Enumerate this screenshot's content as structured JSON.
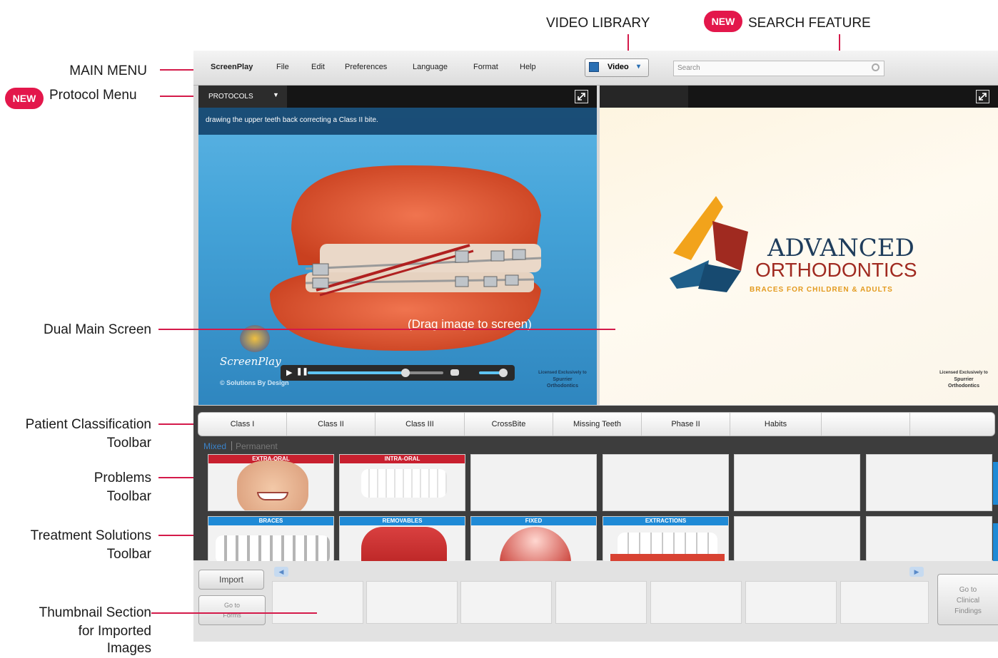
{
  "annotations": {
    "video_library": "VIDEO LIBRARY",
    "search_feature": "SEARCH FEATURE",
    "main_menu": "MAIN MENU",
    "protocol_menu": "Protocol Menu",
    "dual_main_screen": "Dual Main Screen",
    "patient_classification_line1": "Patient Classification",
    "patient_classification_line2": "Toolbar",
    "problems_line1": "Problems",
    "problems_line2": "Toolbar",
    "treatment_line1": "Treatment Solutions",
    "treatment_line2": "Toolbar",
    "thumbnail_line1": "Thumbnail Section",
    "thumbnail_line2": "for Imported",
    "thumbnail_line3": "Images",
    "new_badge": "NEW",
    "drag_hint": "(Drag image to screen)"
  },
  "menu": {
    "items": [
      "ScreenPlay",
      "File",
      "Edit",
      "Preferences",
      "Language",
      "Format",
      "Help"
    ],
    "video_selector": "Video",
    "search_placeholder": "Search"
  },
  "left_screen": {
    "protocols_label": "PROTOCOLS",
    "caption": "drawing the upper teeth back correcting a Class II bite.",
    "logo_script": "ScreenPlay",
    "copyright": "© Solutions By Design",
    "license_line1": "Licensed Exclusively to",
    "license_line2": "Spurrier",
    "license_line3": "Orthodontics",
    "playback_progress": 0.72
  },
  "right_screen": {
    "brand_line1": "ADVANCED",
    "brand_line2": "ORTHODONTICS",
    "brand_tagline": "BRACES FOR CHILDREN & ADULTS",
    "license_line1": "Licensed Exclusively to",
    "license_line2": "Spurrier",
    "license_line3": "Orthodontics"
  },
  "classification_toolbar": {
    "buttons": [
      "Class I",
      "Class II",
      "Class III",
      "CrossBite",
      "Missing Teeth",
      "Phase II",
      "Habits",
      "",
      ""
    ]
  },
  "dentition_toggle": {
    "mixed": "Mixed",
    "permanent": "Permanent"
  },
  "problems_toolbar": {
    "tiles": [
      "EXTRA-ORAL",
      "INTRA-ORAL",
      "",
      "",
      "",
      ""
    ]
  },
  "treatment_toolbar": {
    "tiles": [
      "BRACES",
      "REMOVABLES",
      "FIXED",
      "EXTRACTIONS",
      "",
      ""
    ]
  },
  "thumbnail_section": {
    "import_button": "Import",
    "goto_forms_line1": "Go to",
    "goto_forms_line2": "Forms",
    "goto_clinical_line1": "Go to",
    "goto_clinical_line2": "Clinical",
    "goto_clinical_line3": "Findings"
  },
  "colors": {
    "accent_red": "#d41a4a",
    "problem_header": "#c8202f",
    "treatment_header": "#1f8ad6"
  }
}
